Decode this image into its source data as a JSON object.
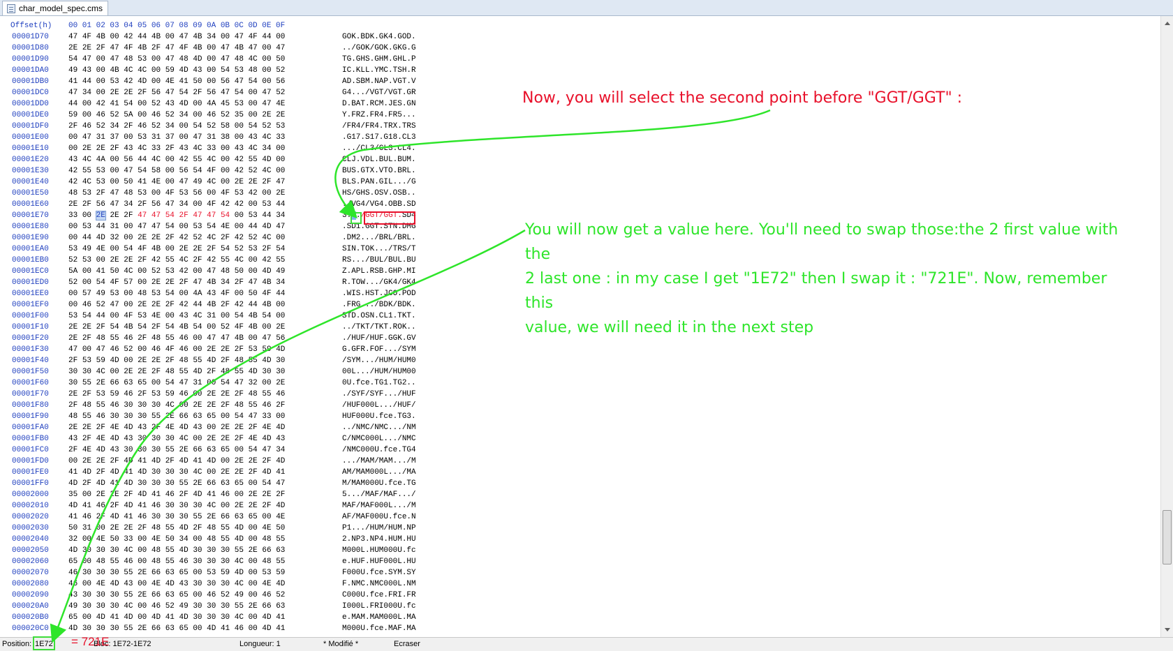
{
  "tab": {
    "title": "char_model_spec.cms"
  },
  "header": {
    "offset_label": "Offset(h)",
    "columns": "00 01 02 03 04 05 06 07 08 09 0A 0B 0C 0D 0E 0F"
  },
  "rows": [
    {
      "off": "00001D70",
      "hex": "47 4F 4B 00 42 44 4B 00 47 4B 34 00 47 4F 44 00",
      "asc": "GOK.BDK.GK4.GOD."
    },
    {
      "off": "00001D80",
      "hex": "2E 2E 2F 47 4F 4B 2F 47 4F 4B 00 47 4B 47 00 47",
      "asc": "../GOK/GOK.GKG.G"
    },
    {
      "off": "00001D90",
      "hex": "54 47 00 47 48 53 00 47 48 4D 00 47 48 4C 00 50",
      "asc": "TG.GHS.GHM.GHL.P"
    },
    {
      "off": "00001DA0",
      "hex": "49 43 00 4B 4C 4C 00 59 4D 43 00 54 53 48 00 52",
      "asc": "IC.KLL.YMC.TSH.R"
    },
    {
      "off": "00001DB0",
      "hex": "41 44 00 53 42 4D 00 4E 41 50 00 56 47 54 00 56",
      "asc": "AD.SBM.NAP.VGT.V"
    },
    {
      "off": "00001DC0",
      "hex": "47 34 00 2E 2E 2F 56 47 54 2F 56 47 54 00 47 52",
      "asc": "G4.../VGT/VGT.GR"
    },
    {
      "off": "00001DD0",
      "hex": "44 00 42 41 54 00 52 43 4D 00 4A 45 53 00 47 4E",
      "asc": "D.BAT.RCM.JES.GN"
    },
    {
      "off": "00001DE0",
      "hex": "59 00 46 52 5A 00 46 52 34 00 46 52 35 00 2E 2E",
      "asc": "Y.FRZ.FR4.FR5..."
    },
    {
      "off": "00001DF0",
      "hex": "2F 46 52 34 2F 46 52 34 00 54 52 58 00 54 52 53",
      "asc": "/FR4/FR4.TRX.TRS"
    },
    {
      "off": "00001E00",
      "hex": "00 47 31 37 00 53 31 37 00 47 31 38 00 43 4C 33",
      "asc": ".G17.S17.G18.CL3"
    },
    {
      "off": "00001E10",
      "hex": "00 2E 2E 2F 43 4C 33 2F 43 4C 33 00 43 4C 34 00",
      "asc": ".../CL3/CL3.CL4."
    },
    {
      "off": "00001E20",
      "hex": "43 4C 4A 00 56 44 4C 00 42 55 4C 00 42 55 4D 00",
      "asc": "CLJ.VDL.BUL.BUM."
    },
    {
      "off": "00001E30",
      "hex": "42 55 53 00 47 54 58 00 56 54 4F 00 42 52 4C 00",
      "asc": "BUS.GTX.VTO.BRL."
    },
    {
      "off": "00001E40",
      "hex": "42 4C 53 00 50 41 4E 00 47 49 4C 00 2E 2E 2F 47",
      "asc": "BLS.PAN.GIL.../G"
    },
    {
      "off": "00001E50",
      "hex": "48 53 2F 47 48 53 00 4F 53 56 00 4F 53 42 00 2E",
      "asc": "HS/GHS.OSV.OSB.."
    },
    {
      "off": "00001E60",
      "hex": "2E 2F 56 47 34 2F 56 47 34 00 4F 42 42 00 53 44",
      "asc": "./VG4/VG4.OBB.SD"
    },
    {
      "off": "00001E70",
      "hex": "33 00 2E 2E 2F 47 47 54 2F 47 47 54 00 53 44 34",
      "asc": "3.../GGT/GGT.SD4"
    },
    {
      "off": "00001E80",
      "hex": "00 53 44 31 00 47 47 54 00 53 54 4E 00 44 4D 47",
      "asc": ".SD1.GGT.STN.DMG"
    },
    {
      "off": "00001E90",
      "hex": "00 44 4D 32 00 2E 2E 2F 42 52 4C 2F 42 52 4C 00",
      "asc": ".DM2.../BRL/BRL."
    },
    {
      "off": "00001EA0",
      "hex": "53 49 4E 00 54 4F 4B 00 2E 2E 2F 54 52 53 2F 54",
      "asc": "SIN.TOK.../TRS/T"
    },
    {
      "off": "00001EB0",
      "hex": "52 53 00 2E 2E 2F 42 55 4C 2F 42 55 4C 00 42 55",
      "asc": "RS.../BUL/BUL.BU"
    },
    {
      "off": "00001EC0",
      "hex": "5A 00 41 50 4C 00 52 53 42 00 47 48 50 00 4D 49",
      "asc": "Z.APL.RSB.GHP.MI"
    },
    {
      "off": "00001ED0",
      "hex": "52 00 54 4F 57 00 2E 2E 2F 47 4B 34 2F 47 4B 34",
      "asc": "R.TOW.../GK4/GK4"
    },
    {
      "off": "00001EE0",
      "hex": "00 57 49 53 00 48 53 54 00 4A 43 4F 00 50 4F 44",
      "asc": ".WIS.HST.JCO.POD"
    },
    {
      "off": "00001EF0",
      "hex": "00 46 52 47 00 2E 2E 2F 42 44 4B 2F 42 44 4B 00",
      "asc": ".FRG.../BDK/BDK."
    },
    {
      "off": "00001F00",
      "hex": "53 54 44 00 4F 53 4E 00 43 4C 31 00 54 4B 54 00",
      "asc": "STD.OSN.CL1.TKT."
    },
    {
      "off": "00001F10",
      "hex": "2E 2E 2F 54 4B 54 2F 54 4B 54 00 52 4F 4B 00 2E",
      "asc": "../TKT/TKT.ROK.."
    },
    {
      "off": "00001F20",
      "hex": "2E 2F 48 55 46 2F 48 55 46 00 47 47 4B 00 47 56",
      "asc": "./HUF/HUF.GGK.GV"
    },
    {
      "off": "00001F30",
      "hex": "47 00 47 46 52 00 46 4F 46 00 2E 2E 2F 53 59 4D",
      "asc": "G.GFR.FOF.../SYM"
    },
    {
      "off": "00001F40",
      "hex": "2F 53 59 4D 00 2E 2E 2F 48 55 4D 2F 48 55 4D 30",
      "asc": "/SYM.../HUM/HUM0"
    },
    {
      "off": "00001F50",
      "hex": "30 30 4C 00 2E 2E 2F 48 55 4D 2F 48 55 4D 30 30",
      "asc": "00L.../HUM/HUM00"
    },
    {
      "off": "00001F60",
      "hex": "30 55 2E 66 63 65 00 54 47 31 00 54 47 32 00 2E",
      "asc": "0U.fce.TG1.TG2.."
    },
    {
      "off": "00001F70",
      "hex": "2E 2F 53 59 46 2F 53 59 46 00 2E 2E 2F 48 55 46",
      "asc": "./SYF/SYF.../HUF"
    },
    {
      "off": "00001F80",
      "hex": "2F 48 55 46 30 30 30 4C 00 2E 2E 2F 48 55 46 2F",
      "asc": "/HUF000L.../HUF/"
    },
    {
      "off": "00001F90",
      "hex": "48 55 46 30 30 30 55 2E 66 63 65 00 54 47 33 00",
      "asc": "HUF000U.fce.TG3."
    },
    {
      "off": "00001FA0",
      "hex": "2E 2E 2F 4E 4D 43 2F 4E 4D 43 00 2E 2E 2F 4E 4D",
      "asc": "../NMC/NMC.../NM"
    },
    {
      "off": "00001FB0",
      "hex": "43 2F 4E 4D 43 30 30 30 4C 00 2E 2E 2F 4E 4D 43",
      "asc": "C/NMC000L.../NMC"
    },
    {
      "off": "00001FC0",
      "hex": "2F 4E 4D 43 30 30 30 55 2E 66 63 65 00 54 47 34",
      "asc": "/NMC000U.fce.TG4"
    },
    {
      "off": "00001FD0",
      "hex": "00 2E 2E 2F 4D 41 4D 2F 4D 41 4D 00 2E 2E 2F 4D",
      "asc": ".../MAM/MAM.../M"
    },
    {
      "off": "00001FE0",
      "hex": "41 4D 2F 4D 41 4D 30 30 30 4C 00 2E 2E 2F 4D 41",
      "asc": "AM/MAM000L.../MA"
    },
    {
      "off": "00001FF0",
      "hex": "4D 2F 4D 41 4D 30 30 30 55 2E 66 63 65 00 54 47",
      "asc": "M/MAM000U.fce.TG"
    },
    {
      "off": "00002000",
      "hex": "35 00 2E 2E 2F 4D 41 46 2F 4D 41 46 00 2E 2E 2F",
      "asc": "5.../MAF/MAF.../"
    },
    {
      "off": "00002010",
      "hex": "4D 41 46 2F 4D 41 46 30 30 30 4C 00 2E 2E 2F 4D",
      "asc": "MAF/MAF000L.../M"
    },
    {
      "off": "00002020",
      "hex": "41 46 2F 4D 41 46 30 30 30 55 2E 66 63 65 00 4E",
      "asc": "AF/MAF000U.fce.N"
    },
    {
      "off": "00002030",
      "hex": "50 31 00 2E 2E 2F 48 55 4D 2F 48 55 4D 00 4E 50",
      "asc": "P1.../HUM/HUM.NP"
    },
    {
      "off": "00002040",
      "hex": "32 00 4E 50 33 00 4E 50 34 00 48 55 4D 00 48 55",
      "asc": "2.NP3.NP4.HUM.HU"
    },
    {
      "off": "00002050",
      "hex": "4D 30 30 30 4C 00 48 55 4D 30 30 30 55 2E 66 63",
      "asc": "M000L.HUM000U.fc"
    },
    {
      "off": "00002060",
      "hex": "65 00 48 55 46 00 48 55 46 30 30 30 4C 00 48 55",
      "asc": "e.HUF.HUF000L.HU"
    },
    {
      "off": "00002070",
      "hex": "46 30 30 30 55 2E 66 63 65 00 53 59 4D 00 53 59",
      "asc": "F000U.fce.SYM.SY"
    },
    {
      "off": "00002080",
      "hex": "46 00 4E 4D 43 00 4E 4D 43 30 30 30 4C 00 4E 4D",
      "asc": "F.NMC.NMC000L.NM"
    },
    {
      "off": "00002090",
      "hex": "43 30 30 30 55 2E 66 63 65 00 46 52 49 00 46 52",
      "asc": "C000U.fce.FRI.FR"
    },
    {
      "off": "000020A0",
      "hex": "49 30 30 30 4C 00 46 52 49 30 30 30 55 2E 66 63",
      "asc": "I000L.FRI000U.fc"
    },
    {
      "off": "000020B0",
      "hex": "65 00 4D 41 4D 00 4D 41 4D 30 30 30 4C 00 4D 41",
      "asc": "e.MAM.MAM000L.MA"
    },
    {
      "off": "000020C0",
      "hex": "4D 30 30 30 55 2E 66 63 65 00 4D 41 46 00 4D 41",
      "asc": "M000U.fce.MAF.MA"
    }
  ],
  "status": {
    "position_label": "Position:",
    "position_value": "1E72",
    "swapped_value": "= 721E",
    "bloc": "Bloc: 1E72-1E72",
    "longueur": "Longueur: 1",
    "modifie": "* Modifié *",
    "ecraser": "Ecraser"
  },
  "annotations": {
    "red_text": "Now, you will select the second point before \"GGT/GGT\" :",
    "green_line1": "You will now get a value here. You'll need to swap those:the 2 first value with the",
    "green_line2": "2 last one : in my case I get \"1E72\" then I swap it : \"721E\". Now, remember this",
    "green_line3": "value, we will need it in the next step"
  },
  "colors": {
    "offset_blue": "#1f3fbf",
    "annotation_red": "#e8102a",
    "annotation_green": "#2ee52a"
  }
}
